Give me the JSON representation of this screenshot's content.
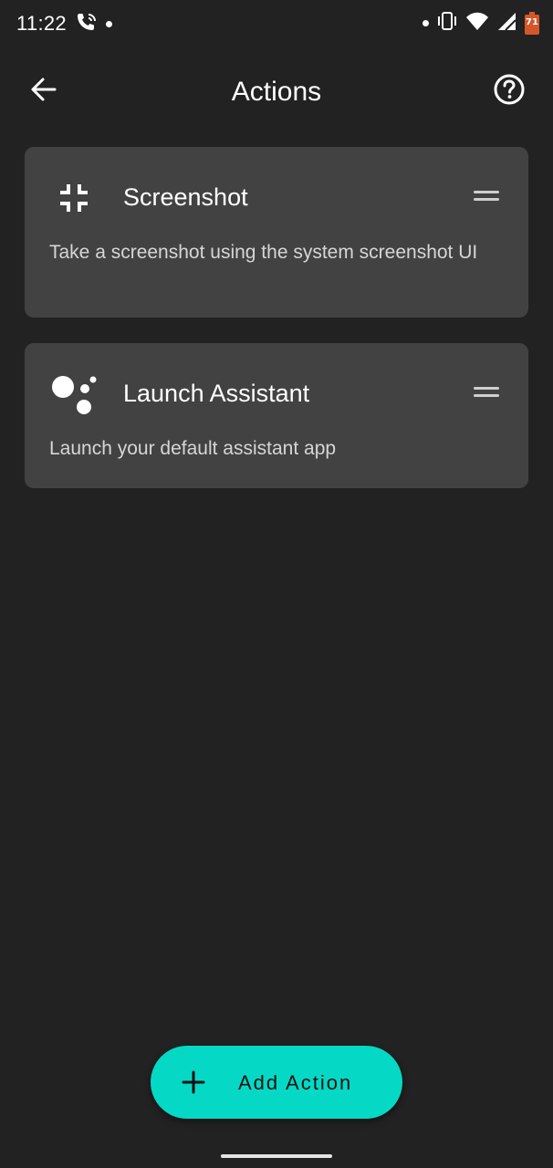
{
  "status_bar": {
    "time": "11:22",
    "left_icons": [
      "wifi-call-icon",
      "notification-dot"
    ],
    "right_icons": [
      "notification-dot",
      "vibrate-icon",
      "wifi-icon",
      "signal-icon",
      "battery-icon"
    ],
    "battery_level": "71"
  },
  "app_bar": {
    "title": "Actions",
    "back_icon": "arrow-back-icon",
    "help_icon": "help-circle-icon"
  },
  "actions": [
    {
      "icon": "fullscreen-exit-icon",
      "title": "Screenshot",
      "description": "Take a screenshot using the system screenshot UI"
    },
    {
      "icon": "google-assistant-icon",
      "title": "Launch Assistant",
      "description": "Launch your default assistant app"
    }
  ],
  "fab": {
    "label": "Add Action",
    "icon": "plus-icon",
    "color": "#05d9c5"
  },
  "colors": {
    "background": "#222222",
    "card": "#424242",
    "text_primary": "#ffffff",
    "text_secondary": "#d6d6d6"
  }
}
